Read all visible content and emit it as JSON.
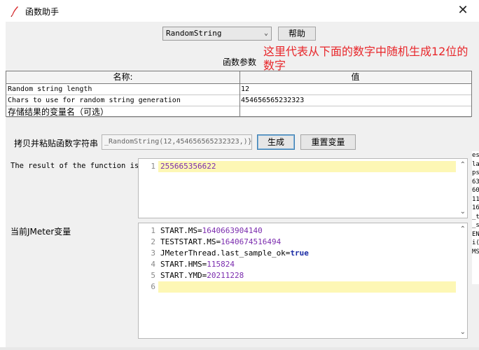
{
  "window": {
    "title": "函数助手",
    "close_label": "✕"
  },
  "function_select": {
    "selected": "RandomString"
  },
  "buttons": {
    "help": "帮助",
    "generate": "生成",
    "reset": "重置变量"
  },
  "params": {
    "section_label": "函数参数",
    "header_name": "名称:",
    "header_value": "值",
    "rows": [
      {
        "name": "Random string length",
        "value": "12"
      },
      {
        "name": "Chars to use for random string generation",
        "value": "454656565232323"
      },
      {
        "name": "存储结果的变量名（可选）",
        "value": ""
      }
    ]
  },
  "annotation": {
    "text": "这里代表从下面的数字中随机生成12位的数字",
    "color": "#e8262a"
  },
  "copy_paste": {
    "label": "拷贝并粘贴函数字符串",
    "value": "_RandomString(12,454656565232323,)}"
  },
  "result": {
    "label": "The result of the function is",
    "line_number": "1",
    "value": "255665356622"
  },
  "jmeter_vars": {
    "label": "当前JMeter变量",
    "lines": [
      {
        "n": "1",
        "key": "START.MS=",
        "val": "1640663904140"
      },
      {
        "n": "2",
        "key": "TESTSTART.MS=",
        "val": "1640674516494"
      },
      {
        "n": "3",
        "key": "JMeterThread.last_sample_ok=",
        "val": "true"
      },
      {
        "n": "4",
        "key": "START.HMS=",
        "val": "115824"
      },
      {
        "n": "5",
        "key": "START.YMD=",
        "val": "20211228"
      },
      {
        "n": "6",
        "key": "",
        "val": ""
      }
    ]
  },
  "background_fragments": [
    "es",
    "la",
    "ps",
    "63",
    "60",
    "11",
    "16",
    "_t",
    "_s",
    "EN",
    "i(",
    "MS"
  ]
}
